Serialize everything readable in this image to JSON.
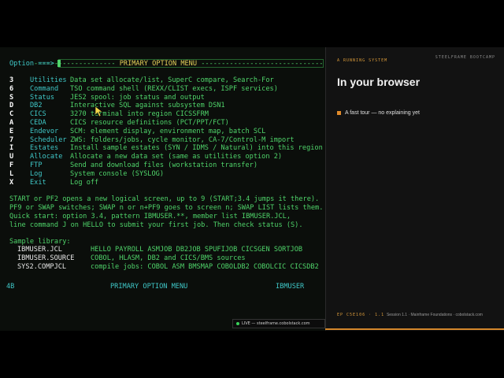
{
  "terminal": {
    "header_left": "--------------------",
    "header_title": "PRIMARY OPTION MENU",
    "header_right": "------------------------------",
    "option_prompt": "Option ===>",
    "options": [
      {
        "key": "3",
        "name": "Utilities",
        "desc": "Data set allocate/list, SuperC compare, Search-For"
      },
      {
        "key": "6",
        "name": "Command",
        "desc": "TSO command shell (REXX/CLIST execs, ISPF services)"
      },
      {
        "key": "S",
        "name": "Status",
        "desc": "JES2 spool: job status and output"
      },
      {
        "key": "D",
        "name": "DB2",
        "desc": "Interactive SQL against subsystem DSN1"
      },
      {
        "key": "C",
        "name": "CICS",
        "desc": "3270 terminal into region CICSSFRM"
      },
      {
        "key": "A",
        "name": "CEDA",
        "desc": "CICS resource definitions (PCT/PPT/FCT)"
      },
      {
        "key": "E",
        "name": "Endevor",
        "desc": "SCM: element display, environment map, batch SCL"
      },
      {
        "key": "7",
        "name": "Scheduler",
        "desc": "ZWS: folders/jobs, cycle monitor, CA-7/Control-M import"
      },
      {
        "key": "I",
        "name": "Estates",
        "desc": "Install sample estates (SYN / IDMS / Natural) into this region"
      },
      {
        "key": "U",
        "name": "Allocate",
        "desc": "Allocate a new data set (same as utilities option 2)"
      },
      {
        "key": "F",
        "name": "FTP",
        "desc": "Send and download files (workstation transfer)"
      },
      {
        "key": "L",
        "name": "Log",
        "desc": "System console (SYSLOG)"
      },
      {
        "key": "X",
        "name": "Exit",
        "desc": "Log off"
      }
    ],
    "help_lines": [
      "START or PF2 opens a new logical screen, up to 9 (START;3.4 jumps it there).",
      "PF9 or SWAP switches; SWAP n or n+PF9 goes to screen n; SWAP LIST lists them.",
      "Quick start: option 3.4, pattern IBMUSER.**, member list IBMUSER.JCL,",
      "line command J on HELLO to submit your first job. Then check status (S)."
    ],
    "sample_library_title": "Sample library:",
    "sample_library": [
      {
        "name": "IBMUSER.JCL",
        "desc": "HELLO PAYROLL ASMJOB DB2JOB SPUFIJOB CICSGEN SORTJOB"
      },
      {
        "name": "IBMUSER.SOURCE",
        "desc": "COBOL, HLASM, DB2 and CICS/BMS sources"
      },
      {
        "name": "SYS2.COMPJCL",
        "desc": "compile jobs: COBOL ASM BMSMAP COBOLDB2 COBOLCIC CICSDB2"
      }
    ],
    "status_left": "4B",
    "status_center": "PRIMARY OPTION MENU",
    "status_right": "IBMUSER",
    "live_badge": "LIVE — steelframe.cobolstack.com"
  },
  "panel": {
    "kicker": "A RUNNING SYSTEM",
    "brand": "STEELFRAME BOOTCAMP",
    "heading": "In your browser",
    "bullet": "A fast tour — no explaining yet",
    "footer_tag": "EP C5E106 · 1.1",
    "footer_text": "Session 1.1 · Mainframe Foundations · cobolstack.com"
  },
  "colors": {
    "accent": "#d3872c",
    "terminal_green": "#4fd46a",
    "terminal_cyan": "#3fc7c7"
  }
}
